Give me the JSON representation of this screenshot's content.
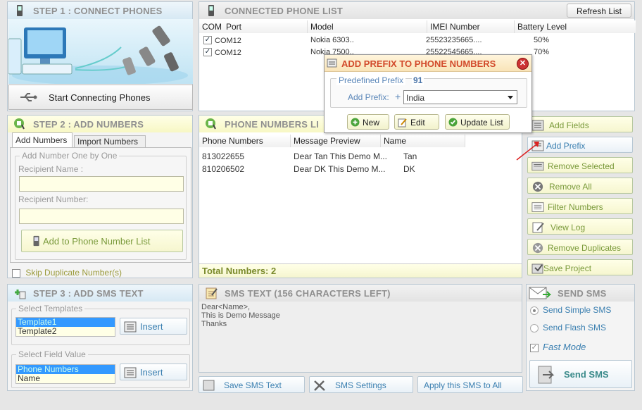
{
  "step1": {
    "title": "STEP 1 : CONNECT PHONES",
    "start_btn": "Start Connecting Phones"
  },
  "phone_list": {
    "title": "CONNECTED PHONE LIST",
    "refresh_btn": "Refresh List",
    "cols": [
      "COM",
      "Port",
      "Model",
      "IMEI Number",
      "Battery Level"
    ],
    "rows": [
      {
        "port": "COM12",
        "model": "Nokia 6303..",
        "imei": "25523235665....",
        "battery": "50%"
      },
      {
        "port": "COM12",
        "model": "Nokia 7500..",
        "imei": "25522545665....",
        "battery": "70%"
      }
    ]
  },
  "prefix_dialog": {
    "title": "ADD PREFIX TO PHONE NUMBERS",
    "predef_label": "Predefined Prefix",
    "predef_value": "91",
    "add_prefix_label": "Add Prefix:",
    "plus": "+",
    "country": "India",
    "new_btn": "New",
    "edit_btn": "Edit",
    "update_btn": "Update List"
  },
  "step2": {
    "title": "STEP 2 : ADD NUMBERS",
    "tab_add": "Add Numbers",
    "tab_import": "Import Numbers",
    "group_label": "Add Number One by One",
    "recipient_name_label": "Recipient Name :",
    "recipient_number_label": "Recipient Number:",
    "add_btn": "Add to Phone Number List",
    "skip_dup": "Skip Duplicate Number(s)"
  },
  "numbers": {
    "title": "PHONE NUMBERS LI",
    "cols": [
      "Phone Numbers",
      "Message Preview",
      "Name"
    ],
    "rows": [
      {
        "phone": "813022655",
        "preview": "Dear Tan This Demo M...",
        "name": "Tan"
      },
      {
        "phone": "810206502",
        "preview": "Dear DK This Demo M...",
        "name": "DK"
      }
    ],
    "total": "Total Numbers: 2"
  },
  "actions": [
    "Add Fields",
    "Add Prefix",
    "Remove Selected",
    "Remove All",
    "Filter Numbers",
    "View Log",
    "Remove Duplicates",
    "Save Project"
  ],
  "step3": {
    "title": "STEP 3 : ADD SMS TEXT",
    "templates_label": "Select Templates",
    "templates": [
      "Template1",
      "Template2"
    ],
    "insert": "Insert",
    "field_label": "Select Field Value",
    "fields": [
      "Phone Numbers",
      "Name"
    ]
  },
  "sms_text": {
    "title": "SMS TEXT (156 CHARACTERS LEFT)",
    "lines": [
      "Dear<Name>,",
      "This is Demo Message",
      "Thanks"
    ],
    "save_btn": "Save SMS Text",
    "settings_btn": "SMS Settings",
    "apply_btn": "Apply this SMS to All"
  },
  "send": {
    "title": "SEND SMS",
    "simple": "Send Simple SMS",
    "flash": "Send Flash SMS",
    "fast": "Fast Mode",
    "send_btn": "Send SMS"
  }
}
